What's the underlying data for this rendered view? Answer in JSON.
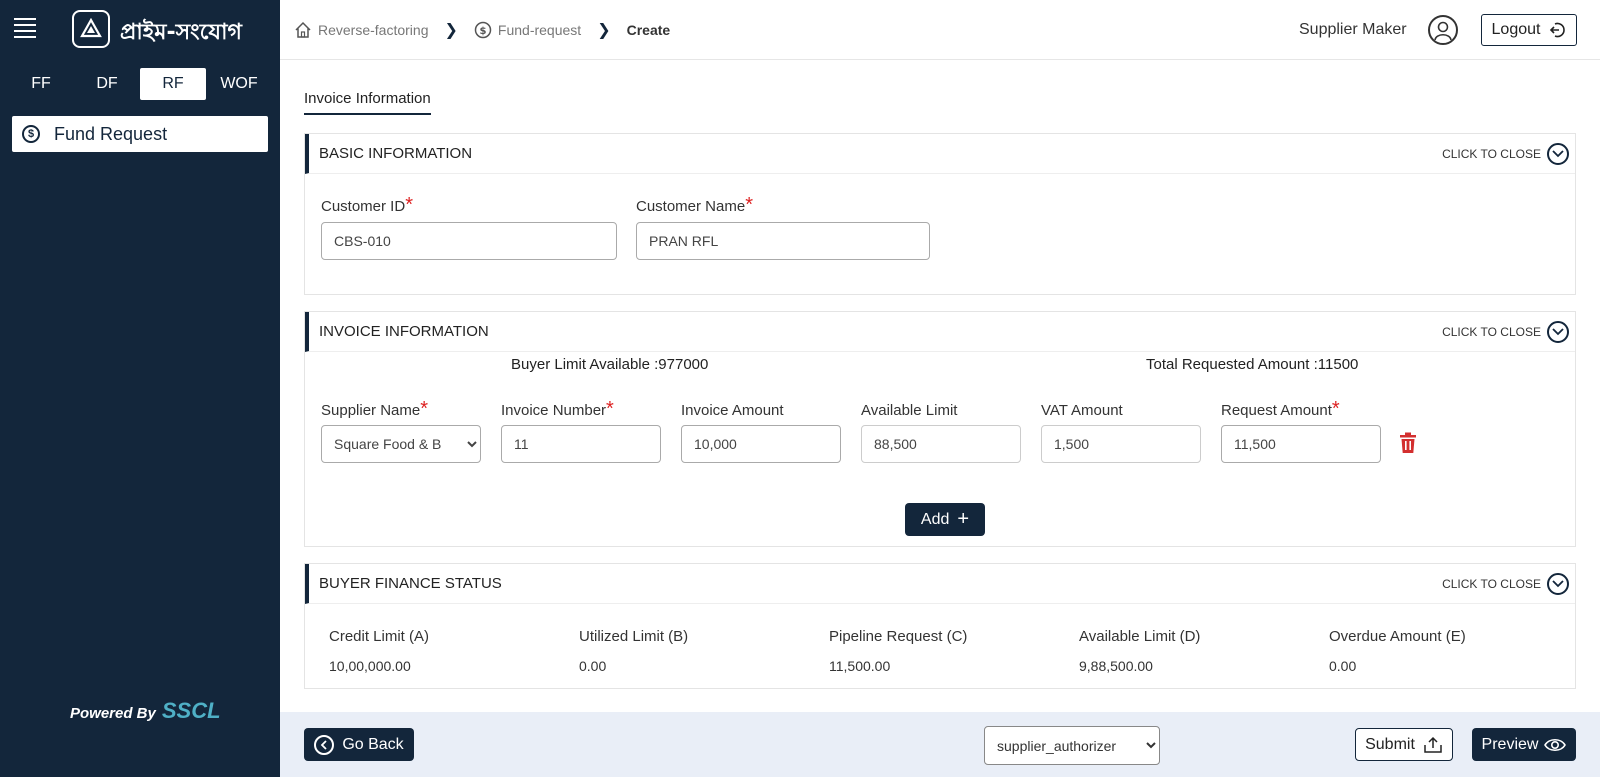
{
  "sidebar": {
    "menu_icon": "hamburger-menu-icon",
    "logo_icon": "prime-logo-icon",
    "app_name": "প্রাইম-সংযোগ",
    "modules": [
      "FF",
      "DF",
      "RF",
      "WOF"
    ],
    "active_module": "RF",
    "items": [
      {
        "label": "Fund Request",
        "icon": "currency-coin-icon"
      }
    ],
    "powered_by": "Powered By",
    "brand": "SSCL"
  },
  "header": {
    "breadcrumb": [
      {
        "label": "Reverse-factoring",
        "icon": "home-icon"
      },
      {
        "label": "Fund-request",
        "icon": "currency-coin-icon"
      },
      {
        "label": "Create"
      }
    ],
    "user_name": "Supplier Maker",
    "logout_label": "Logout"
  },
  "page": {
    "tab_label": "Invoice Information",
    "toggle_label": "CLICK TO CLOSE"
  },
  "basic_info": {
    "title": "BASIC INFORMATION",
    "customer_id_label": "Customer ID",
    "customer_id_value": "CBS-010",
    "customer_name_label": "Customer Name",
    "customer_name_value": "PRAN RFL"
  },
  "invoice_info": {
    "title": "INVOICE INFORMATION",
    "buyer_limit_text": "Buyer Limit Available :977000",
    "total_requested_text": "Total Requested Amount :11500",
    "labels": {
      "supplier_name": "Supplier Name",
      "invoice_number": "Invoice Number",
      "invoice_amount": "Invoice Amount",
      "available_limit": "Available Limit",
      "vat_amount": "VAT Amount",
      "request_amount": "Request Amount"
    },
    "row": {
      "supplier_name": "Square Food & B",
      "invoice_number": "11",
      "invoice_amount": "10,000",
      "available_limit": "88,500",
      "vat_amount": "1,500",
      "request_amount": "11,500"
    },
    "add_label": "Add",
    "required_mark": "*",
    "delete_color": "#d32f2f"
  },
  "buyer_finance": {
    "title": "BUYER FINANCE STATUS",
    "stats": [
      {
        "label": "Credit Limit (A)",
        "value": "10,00,000.00"
      },
      {
        "label": "Utilized Limit (B)",
        "value": "0.00"
      },
      {
        "label": "Pipeline Request (C)",
        "value": "11,500.00"
      },
      {
        "label": "Available Limit (D)",
        "value": "9,88,500.00"
      },
      {
        "label": "Overdue Amount (E)",
        "value": "0.00"
      }
    ]
  },
  "footer": {
    "go_back_label": "Go Back",
    "role_selected": "supplier_authorizer",
    "submit_label": "Submit",
    "preview_label": "Preview"
  },
  "colors": {
    "sidebar_bg": "#13263b",
    "accent": "#13263b",
    "required": "#d22222",
    "footer_bg": "#e9eef7",
    "brand": "#4fb0c6"
  }
}
